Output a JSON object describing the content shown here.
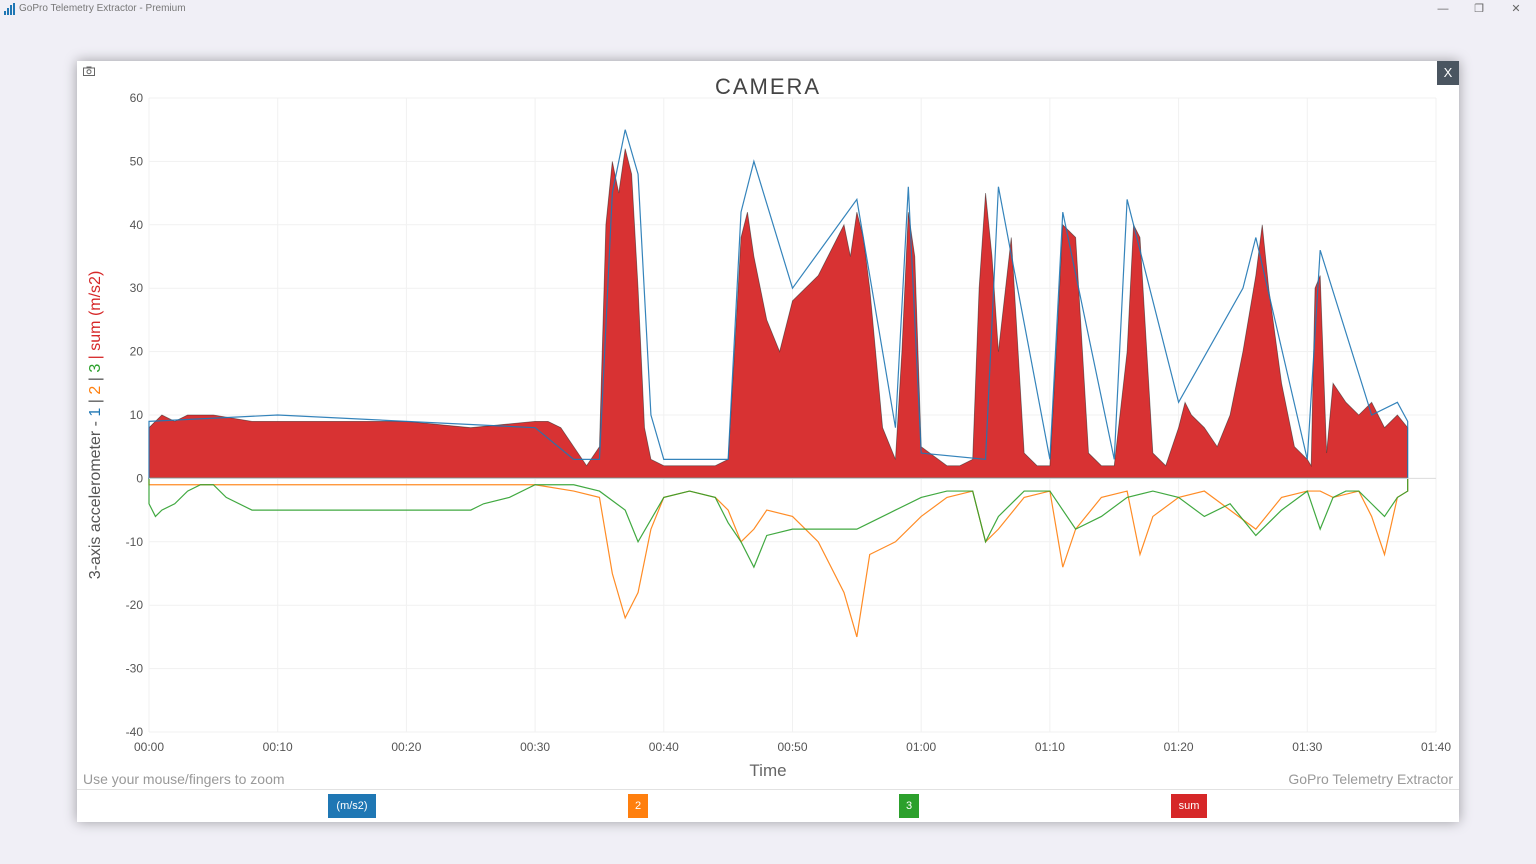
{
  "window": {
    "title": "GoPro Telemetry Extractor - Premium",
    "controls": {
      "minimize": "—",
      "restore": "❐",
      "close": "✕"
    }
  },
  "panel": {
    "close_label": "X",
    "camera_icon": "camera-icon"
  },
  "hint_text": "Use your mouse/fingers to zoom",
  "credit_text": "GoPro Telemetry Extractor",
  "chart_data": {
    "type": "area",
    "title": "CAMERA",
    "xlabel": "Time",
    "ylabel_parts": [
      {
        "text": "3-axis accelerometer - ",
        "color": "#555555"
      },
      {
        "text": "1",
        "color": "#1f77b4"
      },
      {
        "text": " | ",
        "color": "#555555"
      },
      {
        "text": "2",
        "color": "#ff7f0e"
      },
      {
        "text": " | ",
        "color": "#555555"
      },
      {
        "text": "3",
        "color": "#2ca02c"
      },
      {
        "text": " | sum (m/s2)",
        "color": "#d62728"
      }
    ],
    "ylim": [
      -40,
      60
    ],
    "yticks": [
      -40,
      -30,
      -20,
      -10,
      0,
      10,
      20,
      30,
      40,
      50,
      60
    ],
    "xlim": [
      0,
      100
    ],
    "xticks": [
      0,
      10,
      20,
      30,
      40,
      50,
      60,
      70,
      80,
      90,
      100
    ],
    "xtick_labels": [
      "00:00",
      "00:10",
      "00:20",
      "00:30",
      "00:40",
      "00:50",
      "01:00",
      "01:10",
      "01:20",
      "01:30",
      "01:40"
    ],
    "grid": true,
    "legend_placement": "bottom",
    "legend": [
      {
        "label": "(m/s2)",
        "color": "#1f77b4"
      },
      {
        "label": "2",
        "color": "#ff7f0e"
      },
      {
        "label": "3",
        "color": "#2ca02c"
      },
      {
        "label": "sum",
        "color": "#d62728"
      }
    ],
    "series": [
      {
        "name": "sum",
        "color": "#d62728",
        "x": [
          0,
          1,
          2,
          3,
          5,
          8,
          10,
          15,
          20,
          25,
          30,
          31,
          32,
          33,
          34,
          35,
          35.5,
          36,
          36.5,
          37,
          37.5,
          38,
          38.5,
          39,
          40,
          42,
          44,
          45,
          45.5,
          46,
          46.5,
          47,
          48,
          49,
          50,
          51,
          52,
          53,
          54,
          54.5,
          55,
          55.5,
          56,
          57,
          58,
          58.5,
          59,
          59.5,
          60,
          62,
          63,
          64,
          64.5,
          65,
          65.5,
          66,
          67,
          68,
          69,
          70,
          70.5,
          71,
          72,
          73,
          74,
          75,
          76,
          76.5,
          77,
          78,
          79,
          80,
          80.5,
          81,
          82,
          83,
          84,
          85,
          86,
          86.5,
          87,
          88,
          89,
          90,
          90.3,
          90.6,
          91,
          91.5,
          92,
          93,
          94,
          95,
          96,
          97,
          97.8
        ],
        "values": [
          8,
          10,
          9,
          10,
          10,
          9,
          9,
          9,
          9,
          8,
          9,
          9,
          8,
          5,
          2,
          5,
          40,
          50,
          45,
          52,
          48,
          30,
          8,
          3,
          2,
          2,
          2,
          3,
          20,
          38,
          42,
          35,
          25,
          20,
          28,
          30,
          32,
          36,
          40,
          35,
          42,
          38,
          30,
          8,
          3,
          20,
          42,
          35,
          5,
          2,
          2,
          3,
          30,
          45,
          35,
          20,
          38,
          4,
          2,
          2,
          20,
          40,
          38,
          4,
          2,
          2,
          20,
          40,
          38,
          4,
          2,
          8,
          12,
          10,
          8,
          5,
          10,
          20,
          32,
          40,
          30,
          15,
          5,
          3,
          2,
          30,
          32,
          4,
          15,
          12,
          10,
          12,
          8,
          10,
          8
        ]
      },
      {
        "name": "2",
        "color": "#ff7f0e",
        "x": [
          0,
          10,
          20,
          30,
          33,
          35,
          36,
          37,
          38,
          39,
          40,
          42,
          44,
          45,
          46,
          47,
          48,
          50,
          52,
          54,
          55,
          56,
          58,
          60,
          62,
          64,
          65,
          66,
          68,
          70,
          71,
          72,
          74,
          76,
          77,
          78,
          80,
          82,
          84,
          86,
          88,
          90,
          91,
          92,
          94,
          95,
          96,
          97,
          97.8
        ],
        "values": [
          -1,
          -1,
          -1,
          -1,
          -2,
          -3,
          -15,
          -22,
          -18,
          -8,
          -3,
          -2,
          -3,
          -5,
          -10,
          -8,
          -5,
          -6,
          -10,
          -18,
          -25,
          -12,
          -10,
          -6,
          -3,
          -2,
          -10,
          -8,
          -3,
          -2,
          -14,
          -8,
          -3,
          -2,
          -12,
          -6,
          -3,
          -2,
          -5,
          -8,
          -3,
          -2,
          -2,
          -3,
          -2,
          -6,
          -12,
          -3,
          -2
        ]
      },
      {
        "name": "3",
        "color": "#2ca02c",
        "x": [
          0,
          0.5,
          1,
          2,
          3,
          4,
          5,
          6,
          8,
          10,
          15,
          20,
          25,
          26,
          28,
          30,
          31,
          32,
          33,
          35,
          37,
          38,
          40,
          42,
          44,
          45,
          46,
          47,
          48,
          50,
          52,
          54,
          55,
          56,
          58,
          60,
          62,
          64,
          65,
          66,
          68,
          70,
          72,
          74,
          76,
          78,
          80,
          82,
          84,
          86,
          88,
          90,
          91,
          92,
          93,
          94,
          95,
          96,
          97,
          97.8
        ],
        "values": [
          -4,
          -6,
          -5,
          -4,
          -2,
          -1,
          -1,
          -3,
          -5,
          -5,
          -5,
          -5,
          -5,
          -4,
          -3,
          -1,
          -1,
          -1,
          -1,
          -2,
          -5,
          -10,
          -3,
          -2,
          -3,
          -7,
          -10,
          -14,
          -9,
          -8,
          -8,
          -8,
          -8,
          -7,
          -5,
          -3,
          -2,
          -2,
          -10,
          -6,
          -2,
          -2,
          -8,
          -6,
          -3,
          -2,
          -3,
          -6,
          -4,
          -9,
          -5,
          -2,
          -8,
          -3,
          -2,
          -2,
          -4,
          -6,
          -3,
          -2
        ]
      },
      {
        "name": "1",
        "color": "#1f77b4",
        "x": [
          0,
          10,
          20,
          30,
          33,
          35,
          36,
          37,
          38,
          39,
          40,
          45,
          46,
          47,
          50,
          55,
          58,
          59,
          60,
          65,
          66,
          70,
          71,
          75,
          76,
          80,
          85,
          86,
          90,
          91,
          95,
          97,
          97.8
        ],
        "values": [
          9,
          10,
          9,
          8,
          3,
          3,
          45,
          55,
          48,
          10,
          3,
          3,
          42,
          50,
          30,
          44,
          8,
          46,
          4,
          3,
          46,
          3,
          42,
          3,
          44,
          12,
          30,
          38,
          3,
          36,
          10,
          12,
          9
        ]
      }
    ]
  }
}
